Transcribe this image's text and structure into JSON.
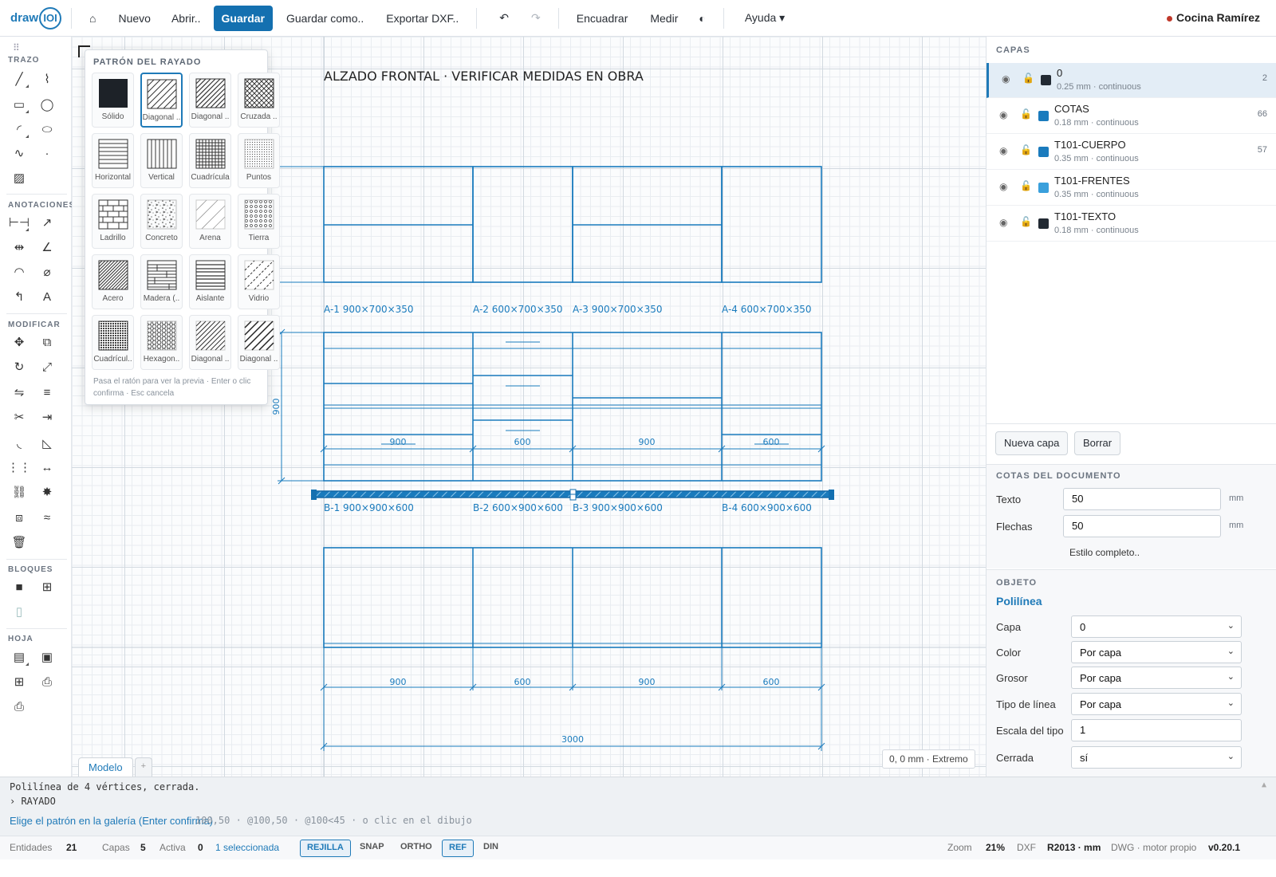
{
  "app": {
    "logo": "draw",
    "logo_mark": "IOI",
    "document": "Cocina Ramírez"
  },
  "toolbar": {
    "home": "⌂",
    "new": "Nuevo",
    "open": "Abrir..",
    "save": "Guardar",
    "save_as": "Guardar como..",
    "export": "Exportar DXF..",
    "undo": "↶",
    "redo": "↷",
    "fit": "Encuadrar",
    "measure": "Medir",
    "theme": "◐",
    "help": "Ayuda ▾"
  },
  "toolbox": {
    "sections": {
      "trazo": "TRAZO",
      "anotaciones": "ANOTACIONES",
      "modificar": "MODIFICAR",
      "bloques": "BLOQUES",
      "hoja": "HOJA"
    }
  },
  "hatch_gallery": {
    "title": "PATRÓN DEL RAYADO",
    "selected": "Diagonal ..",
    "patterns": [
      "Sólido",
      "Diagonal ..",
      "Diagonal ..",
      "Cruzada ..",
      "Horizontal",
      "Vertical",
      "Cuadrícula",
      "Puntos",
      "Ladrillo",
      "Concreto",
      "Arena",
      "Tierra",
      "Acero",
      "Madera (..",
      "Aislante",
      "Vidrio",
      "Cuadrícul..",
      "Hexagon..",
      "Diagonal ..",
      "Diagonal .."
    ],
    "hint": "Pasa el ratón para ver la previa · Enter o clic confirma · Esc cancela"
  },
  "drawing": {
    "title": "ALZADO FRONTAL · VERIFICAR MEDIDAS EN OBRA",
    "upper_labels": [
      "A-1  900×700×350",
      "A-2  600×700×350",
      "A-3  900×700×350",
      "A-4  600×700×350"
    ],
    "lower_labels": [
      "B-1  900×900×600",
      "B-2  600×900×600",
      "B-3  900×900×600",
      "B-4  600×900×600"
    ],
    "dims_mid": [
      "900",
      "600",
      "900",
      "600"
    ],
    "dim_vertical": "900",
    "dims_bottom": [
      "900",
      "600",
      "900",
      "600"
    ],
    "dim_total": "3000"
  },
  "layers": {
    "title": "CAPAS",
    "items": [
      {
        "name": "0",
        "sub": "0.25 mm · continuous",
        "count": "2",
        "color": "#222a33",
        "active": true
      },
      {
        "name": "COTAS",
        "sub": "0.18 mm · continuous",
        "count": "66",
        "color": "#1a7bbd"
      },
      {
        "name": "T101-CUERPO",
        "sub": "0.35 mm · continuous",
        "count": "57",
        "color": "#1a7bbd"
      },
      {
        "name": "T101-FRENTES",
        "sub": "0.35 mm · continuous",
        "count": "",
        "color": "#3aa0dc"
      },
      {
        "name": "T101-TEXTO",
        "sub": "0.18 mm · continuous",
        "count": "",
        "color": "#222a33"
      }
    ],
    "new_layer": "Nueva capa",
    "delete": "Borrar"
  },
  "doc_dims": {
    "title": "COTAS DEL DOCUMENTO",
    "text_label": "Texto",
    "text_value": "50",
    "arrows_label": "Flechas",
    "arrows_value": "50",
    "unit": "mm",
    "full_style": "Estilo completo.."
  },
  "object": {
    "title": "OBJETO",
    "type": "Polilínea",
    "fields": [
      {
        "label": "Capa",
        "value": "0"
      },
      {
        "label": "Color",
        "value": "Por capa"
      },
      {
        "label": "Grosor",
        "value": "Por capa"
      },
      {
        "label": "Tipo de línea",
        "value": "Por capa"
      },
      {
        "label": "Escala del tipo",
        "value": "1"
      },
      {
        "label": "Cerrada",
        "value": "sí"
      }
    ]
  },
  "sheet_tabs": {
    "model": "Modelo",
    "add": "+"
  },
  "coord_readout": "0, 0 mm · Extremo",
  "command": {
    "history1": "Polilínea de 4 vértices, cerrada.",
    "history2": "› RAYADO",
    "prompt": "Elige el patrón en la galería (Enter confirma)",
    "input_hint": "100,50 · @100,50 · @100<45 · o clic en el dibujo",
    "expand": "▲"
  },
  "status": {
    "entities_label": "Entidades",
    "entities": "21",
    "layers_label": "Capas",
    "layers": "5",
    "active_label": "Activa",
    "active": "0",
    "selected": "1 seleccionada",
    "toggles": [
      {
        "label": "REJILLA",
        "on": true
      },
      {
        "label": "SNAP",
        "on": false
      },
      {
        "label": "ORTHO",
        "on": false
      },
      {
        "label": "REF",
        "on": true
      },
      {
        "label": "DIN",
        "on": false
      }
    ],
    "zoom_label": "Zoom",
    "zoom": "21%",
    "dxf_label": "DXF",
    "dxf": "R2013 · mm",
    "engine": "DWG · motor propio",
    "version": "v0.20.1"
  }
}
